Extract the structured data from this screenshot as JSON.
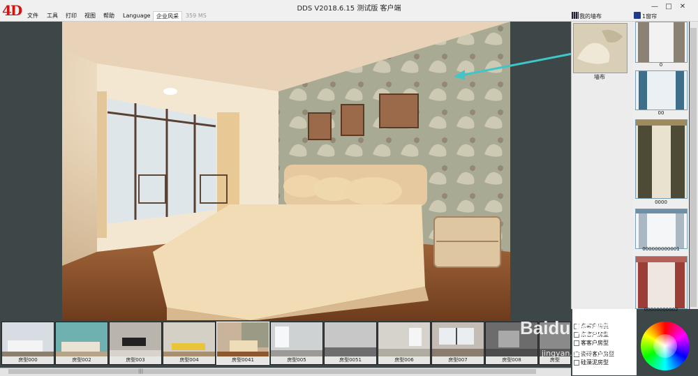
{
  "app": {
    "logo": "4D",
    "title": "DDS V2018.6.15 测试版 客户端",
    "ms": "359 MS"
  },
  "menu": [
    "文件",
    "工具",
    "打印",
    "视图",
    "帮助",
    "Language",
    "企业风采"
  ],
  "right": {
    "wall_tab": "我的墙布",
    "curtain_tab": "1窗帘",
    "wall_item_name": "墙布",
    "curtains": [
      "0",
      "00",
      "0000",
      "000000000001",
      "00000000002"
    ]
  },
  "rooms": [
    "房型000",
    "房型002",
    "房型003",
    "房型004",
    "房型0041",
    "房型005",
    "房型0051",
    "房型006",
    "房型007",
    "房型008",
    "房型"
  ],
  "roomtypes": [
    "东客户房型",
    "东客户房型",
    "客客户房型",
    "瓷砖客户房型",
    "硅藻泥房型"
  ],
  "watermark": {
    "main": "Baidu 经验",
    "sub": "jingyan.baidu.com"
  },
  "colors": {
    "accent_arrow": "#3ec6c9",
    "logo_red": "#d21414",
    "bg_dark": "#3d4747"
  }
}
